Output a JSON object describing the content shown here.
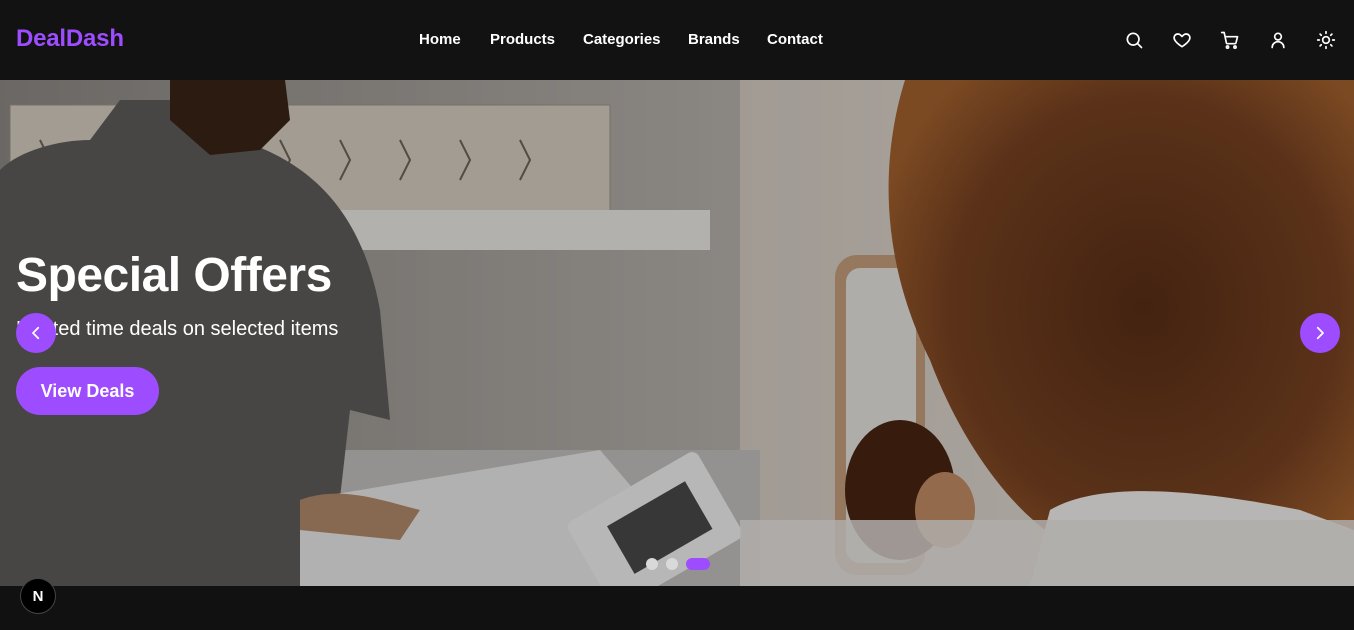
{
  "brand": {
    "name": "DealDash",
    "accent": "#9d4dff"
  },
  "nav": {
    "items": [
      {
        "label": "Home"
      },
      {
        "label": "Products"
      },
      {
        "label": "Categories"
      },
      {
        "label": "Brands"
      },
      {
        "label": "Contact"
      }
    ]
  },
  "header_icons": [
    "search-icon",
    "heart-icon",
    "cart-icon",
    "user-icon",
    "sun-icon"
  ],
  "hero": {
    "title": "Special Offers",
    "subtitle": "Limited time deals on selected items",
    "cta_label": "View Deals",
    "slide_count": 3,
    "active_slide": 3
  },
  "dev_badge": {
    "label": "N"
  }
}
